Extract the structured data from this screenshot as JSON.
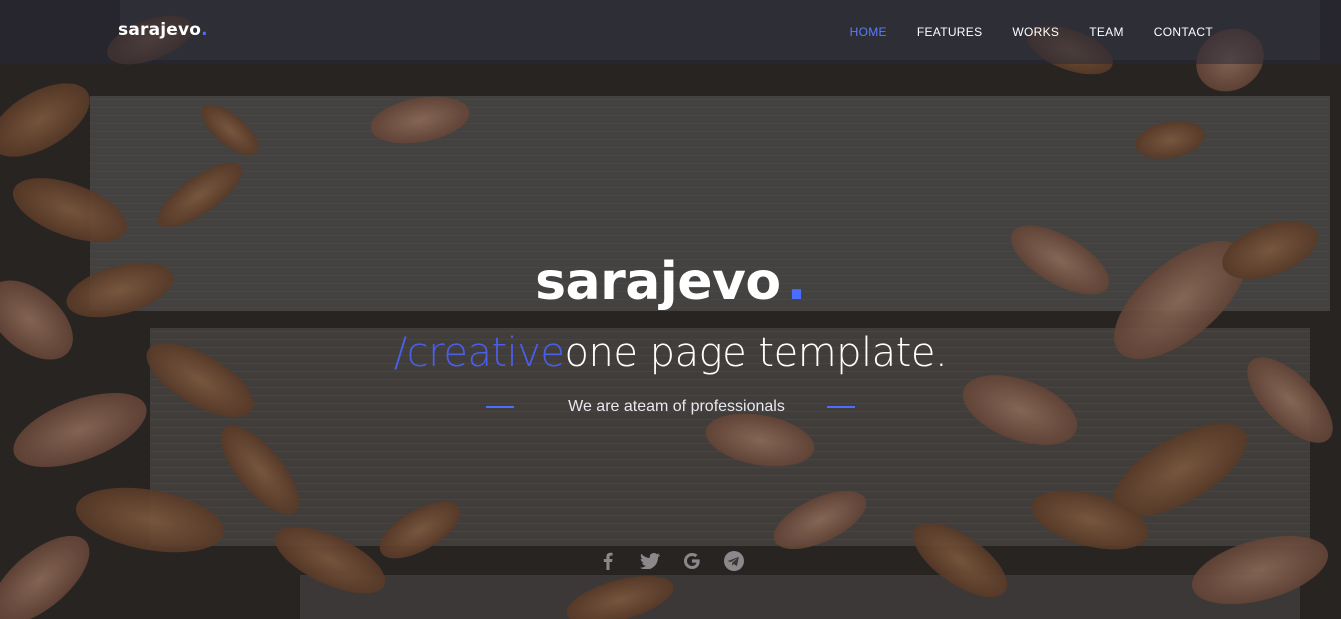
{
  "brand": {
    "name": "sarajevo",
    "dot": "."
  },
  "nav": {
    "items": [
      {
        "label": "HOME",
        "active": true
      },
      {
        "label": "FEATURES",
        "active": false
      },
      {
        "label": "WORKS",
        "active": false
      },
      {
        "label": "TEAM",
        "active": false
      },
      {
        "label": "CONTACT",
        "active": false
      }
    ]
  },
  "hero": {
    "title": "sarajevo",
    "title_dot": ".",
    "subtitle_accent": "/creative",
    "subtitle_rest": "one page template.",
    "tagline": "We are ateam of professionals"
  },
  "social": {
    "icons": [
      "facebook-icon",
      "twitter-icon",
      "google-icon",
      "telegram-icon"
    ]
  },
  "colors": {
    "accent": "#4a6cff",
    "nav_active": "#5b7cff",
    "text": "#ffffff"
  }
}
